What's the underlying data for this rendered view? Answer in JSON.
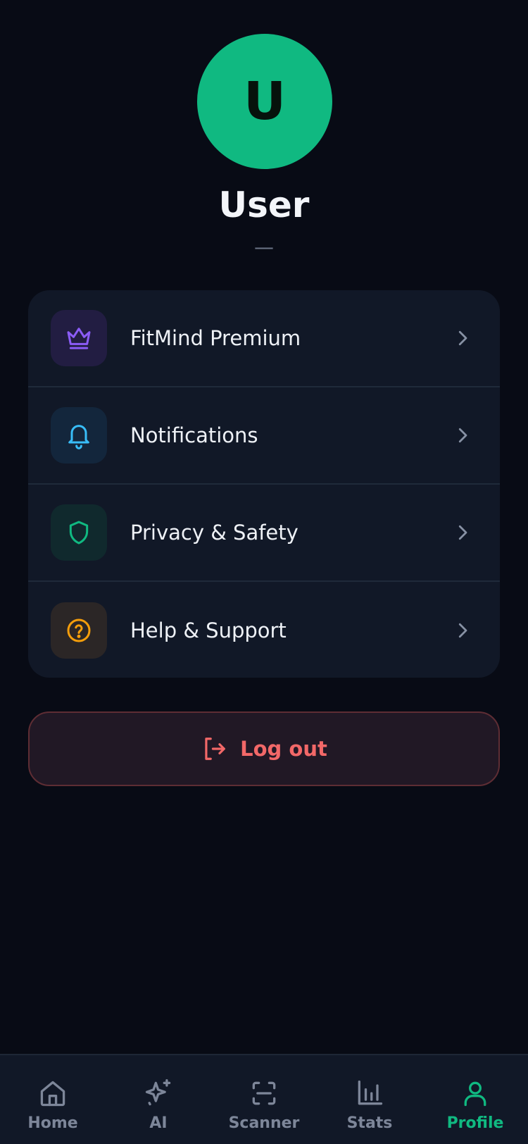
{
  "profile": {
    "avatar_initial": "U",
    "name": "User",
    "subline": "—",
    "avatar_color": "#10b981"
  },
  "menu": {
    "items": [
      {
        "label": "FitMind Premium",
        "icon": "crown-icon",
        "color": "#8b5cf6",
        "bg": "#221d42"
      },
      {
        "label": "Notifications",
        "icon": "bell-icon",
        "color": "#38bdf8",
        "bg": "#13263c"
      },
      {
        "label": "Privacy & Safety",
        "icon": "shield-icon",
        "color": "#10b981",
        "bg": "#10292d"
      },
      {
        "label": "Help & Support",
        "icon": "help-circle-icon",
        "color": "#f59e0b",
        "bg": "#2b2626"
      }
    ]
  },
  "logout": {
    "label": "Log out",
    "icon": "logout-icon",
    "color": "#f26868"
  },
  "tabbar": {
    "active_color": "#10b981",
    "inactive_color": "#7d8699",
    "tabs": [
      {
        "label": "Home",
        "icon": "home-icon",
        "active": false
      },
      {
        "label": "AI",
        "icon": "sparkles-icon",
        "active": false
      },
      {
        "label": "Scanner",
        "icon": "scan-icon",
        "active": false
      },
      {
        "label": "Stats",
        "icon": "bar-chart-icon",
        "active": false
      },
      {
        "label": "Profile",
        "icon": "user-icon",
        "active": true
      }
    ]
  }
}
